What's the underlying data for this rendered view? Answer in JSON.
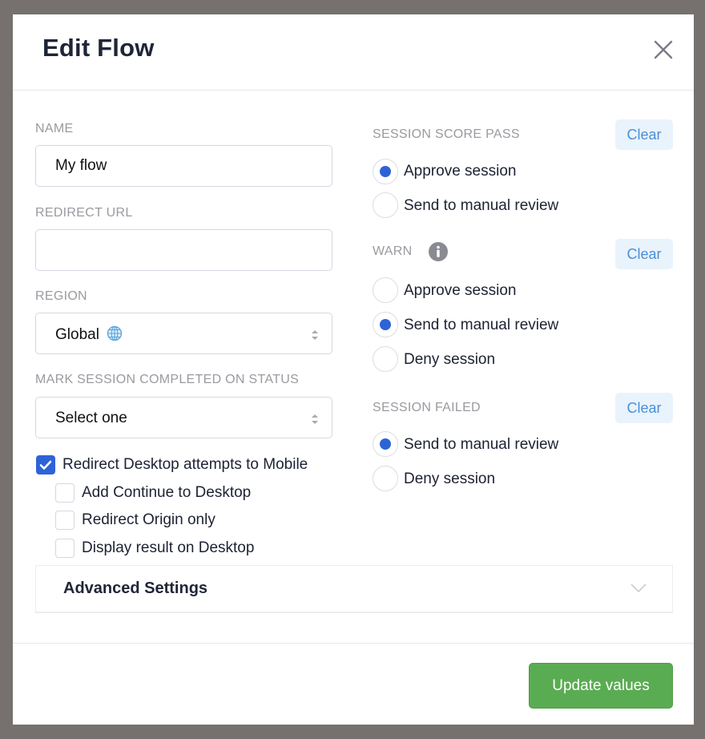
{
  "modal": {
    "title": "Edit Flow",
    "close_icon": "close-icon"
  },
  "form": {
    "name": {
      "label": "NAME",
      "value": "My flow"
    },
    "redirect_url": {
      "label": "REDIRECT URL",
      "value": "",
      "placeholder": ""
    },
    "region": {
      "label": "REGION",
      "selected": "Global",
      "icon": "globe-icon"
    },
    "mark_session": {
      "label": "MARK SESSION COMPLETED ON STATUS",
      "selected": "Select one"
    },
    "checkboxes": [
      {
        "label": "Redirect Desktop attempts to Mobile",
        "checked": true
      },
      {
        "label": "Add Continue to Desktop",
        "checked": false
      },
      {
        "label": "Redirect Origin only",
        "checked": false
      },
      {
        "label": "Display result on Desktop",
        "checked": false
      }
    ],
    "advanced": {
      "label": "Advanced Settings",
      "expanded": false
    }
  },
  "decisions": {
    "clear_label": "Clear",
    "session_score_pass": {
      "label": "SESSION SCORE PASS",
      "options": [
        {
          "label": "Approve session",
          "selected": true
        },
        {
          "label": "Send to manual review",
          "selected": false
        }
      ]
    },
    "warn": {
      "label": "WARN",
      "info_icon": "info-icon",
      "options": [
        {
          "label": "Approve session",
          "selected": false
        },
        {
          "label": "Send to manual review",
          "selected": true
        },
        {
          "label": "Deny session",
          "selected": false
        }
      ]
    },
    "session_failed": {
      "label": "SESSION FAILED",
      "options": [
        {
          "label": "Send to manual review",
          "selected": true
        },
        {
          "label": "Deny session",
          "selected": false
        }
      ]
    }
  },
  "footer": {
    "submit_label": "Update values"
  },
  "colors": {
    "accent": "#2e63d8",
    "submit": "#5aac52",
    "clear_text": "#4a90d6",
    "clear_bg": "#e9f3fc",
    "backdrop": "#76716f"
  }
}
